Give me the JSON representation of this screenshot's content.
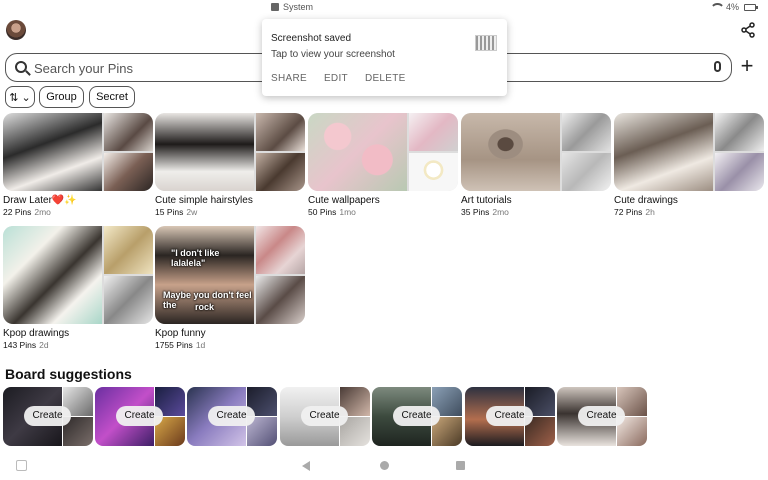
{
  "status_bar": {
    "system_label": "System",
    "battery_text": "4%"
  },
  "search": {
    "placeholder": "Search your Pins"
  },
  "filters": {
    "group_label": "Group",
    "secret_label": "Secret"
  },
  "toast": {
    "title": "Screenshot saved",
    "subtitle": "Tap to view your screenshot",
    "actions": [
      "SHARE",
      "EDIT",
      "DELETE"
    ]
  },
  "boards": [
    {
      "name": "Draw Later",
      "emoji": "❤️✨",
      "pins": "22 Pins",
      "ago": "2mo"
    },
    {
      "name": "Cute simple hairstyles",
      "pins": "15 Pins",
      "ago": "2w"
    },
    {
      "name": "Cute wallpapers",
      "pins": "50 Pins",
      "ago": "1mo"
    },
    {
      "name": "Art tutorials",
      "pins": "35 Pins",
      "ago": "2mo"
    },
    {
      "name": "Cute drawings",
      "pins": "72 Pins",
      "ago": "2h"
    },
    {
      "name": "Kpop drawings",
      "pins": "143 Pins",
      "ago": "2d"
    },
    {
      "name": "Kpop funny",
      "pins": "1755 Pins",
      "ago": "1d"
    }
  ],
  "pin_captions": {
    "line1": "\"I don't like lalalela\"",
    "line2": "Maybe you don't feel the",
    "line3": "rock"
  },
  "suggestions": {
    "title": "Board suggestions",
    "create_label": "Create"
  }
}
